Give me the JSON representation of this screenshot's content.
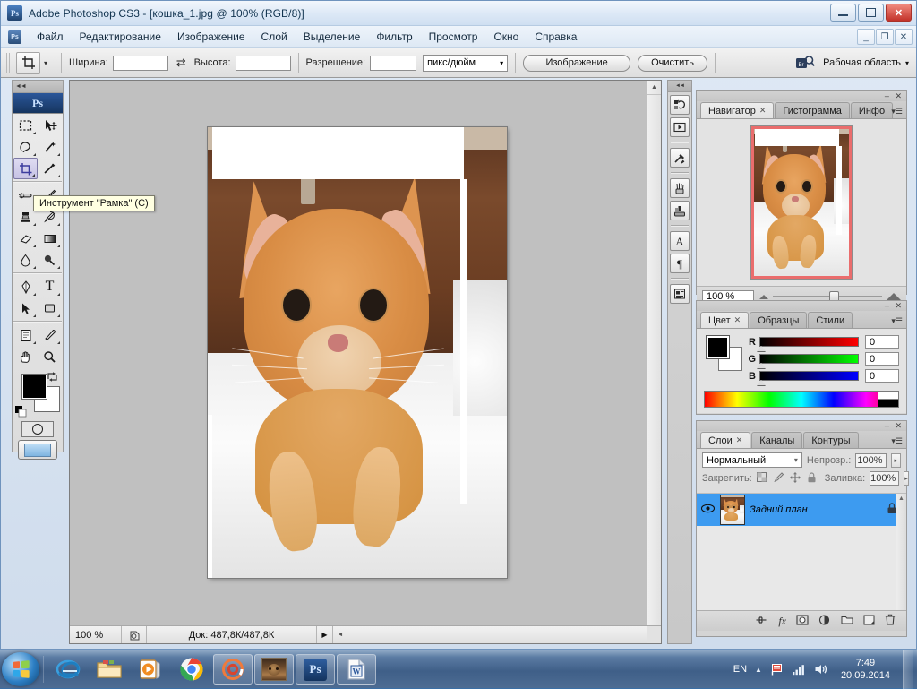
{
  "window": {
    "app_icon": "photoshop-icon",
    "title": "Adobe Photoshop CS3 - [кошка_1.jpg @ 100% (RGB/8)]",
    "minimize": "–",
    "maximize": "□",
    "close": "✕"
  },
  "menubar": {
    "items": [
      {
        "label": "Файл"
      },
      {
        "label": "Редактирование"
      },
      {
        "label": "Изображение"
      },
      {
        "label": "Слой"
      },
      {
        "label": "Выделение"
      },
      {
        "label": "Фильтр"
      },
      {
        "label": "Просмотр"
      },
      {
        "label": "Окно"
      },
      {
        "label": "Справка"
      }
    ],
    "doc_minimize": "_",
    "doc_restore": "❐",
    "doc_close": "✕"
  },
  "options_bar": {
    "tool_icon": "crop-tool-icon",
    "preset_caret": "▾",
    "width_label": "Ширина:",
    "width_value": "",
    "swap_icon": "⇄",
    "height_label": "Высота:",
    "height_value": "",
    "resolution_label": "Разрешение:",
    "resolution_value": "",
    "units_value": "пикс/дюйм",
    "units_caret": "▾",
    "image_button": "Изображение",
    "clear_button": "Очистить",
    "bridge_icon": "bridge-icon",
    "workspace_label": "Рабочая область",
    "workspace_caret": "▾"
  },
  "tool_palette": {
    "collapse_icon": "◄◄",
    "logo": "Ps",
    "tools": [
      {
        "name": "marquee-tool",
        "glyph": "▭"
      },
      {
        "name": "move-tool",
        "glyph": "➤"
      },
      {
        "name": "lasso-tool",
        "glyph": "◔"
      },
      {
        "name": "magic-wand-tool",
        "glyph": "✦"
      },
      {
        "name": "crop-tool",
        "glyph": "⌗",
        "active": true
      },
      {
        "name": "slice-tool",
        "glyph": "✂"
      },
      {
        "name": "healing-brush-tool",
        "glyph": "✏"
      },
      {
        "name": "brush-tool",
        "glyph": "🖌"
      },
      {
        "name": "clone-stamp-tool",
        "glyph": "⚑"
      },
      {
        "name": "history-brush-tool",
        "glyph": "↻"
      },
      {
        "name": "eraser-tool",
        "glyph": "▱"
      },
      {
        "name": "gradient-tool",
        "glyph": "▮"
      },
      {
        "name": "blur-tool",
        "glyph": "💧"
      },
      {
        "name": "dodge-tool",
        "glyph": "◕"
      },
      {
        "name": "pen-tool",
        "glyph": "✒"
      },
      {
        "name": "type-tool",
        "glyph": "T"
      },
      {
        "name": "path-selection-tool",
        "glyph": "➘"
      },
      {
        "name": "shape-tool",
        "glyph": "▢"
      },
      {
        "name": "notes-tool",
        "glyph": "🗒"
      },
      {
        "name": "eyedropper-tool",
        "glyph": "⚲"
      },
      {
        "name": "hand-tool",
        "glyph": "✋"
      },
      {
        "name": "zoom-tool",
        "glyph": "🔍"
      }
    ],
    "swap_colors_icon": "⇄",
    "default_colors_icon": "default-colors",
    "foreground_color": "#000000",
    "background_color": "#ffffff",
    "quick_mask_icon": "quick-mask-icon",
    "screen_mode_icon": "screen-mode-icon"
  },
  "tooltip": {
    "text": "Инструмент \"Рамка\" (C)"
  },
  "document": {
    "zoom": "100 %",
    "doc_size_icon": "doc-info-icon",
    "doc_info": "Док: 487,8К/487,8К",
    "status_arrow": "▶",
    "hscroll_left": "◄",
    "vscroll_up": "▲",
    "vscroll_down": "▼"
  },
  "dock_strip": {
    "grip": "◄◄",
    "buttons": [
      {
        "name": "history-panel-icon",
        "glyph": "↺"
      },
      {
        "name": "actions-panel-icon",
        "glyph": "▶"
      },
      {
        "name": "tool-presets-panel-icon",
        "glyph": "⚒"
      },
      {
        "name": "brushes-panel-icon",
        "glyph": "🖌"
      },
      {
        "name": "clone-source-panel-icon",
        "glyph": "⚗"
      },
      {
        "name": "character-panel-icon",
        "glyph": "A"
      },
      {
        "name": "paragraph-panel-icon",
        "glyph": "¶"
      },
      {
        "name": "layer-comps-panel-icon",
        "glyph": "▤"
      }
    ]
  },
  "navigator_panel": {
    "minimize": "–",
    "close": "✕",
    "menu_icon": "▾☰",
    "tabs": [
      {
        "label": "Навигатор",
        "active": true,
        "close": "✕"
      },
      {
        "label": "Гистограмма",
        "active": false
      },
      {
        "label": "Инфо",
        "active": false
      }
    ],
    "zoom_value": "100 %",
    "zoom_out_icon": "zoom-out-icon",
    "zoom_in_icon": "zoom-in-icon",
    "view_box_color": "#ea6d6d"
  },
  "color_panel": {
    "minimize": "–",
    "close": "✕",
    "menu_icon": "▾☰",
    "tabs": [
      {
        "label": "Цвет",
        "active": true,
        "close": "✕"
      },
      {
        "label": "Образцы",
        "active": false
      },
      {
        "label": "Стили",
        "active": false
      }
    ],
    "channels": [
      {
        "label": "R",
        "value": "0"
      },
      {
        "label": "G",
        "value": "0"
      },
      {
        "label": "B",
        "value": "0"
      }
    ],
    "foreground": "#000000",
    "background": "#ffffff"
  },
  "layers_panel": {
    "minimize": "–",
    "close": "✕",
    "menu_icon": "▾☰",
    "tabs": [
      {
        "label": "Слои",
        "active": true,
        "close": "✕"
      },
      {
        "label": "Каналы",
        "active": false
      },
      {
        "label": "Контуры",
        "active": false
      }
    ],
    "blend_mode": "Нормальный",
    "blend_caret": "▾",
    "opacity_label": "Непрозр.:",
    "opacity_value": "100%",
    "opacity_caret": "▸",
    "lock_label": "Закрепить:",
    "lock_icons": [
      {
        "name": "lock-transparency-icon",
        "glyph": "▨"
      },
      {
        "name": "lock-image-icon",
        "glyph": "🖌"
      },
      {
        "name": "lock-position-icon",
        "glyph": "✥"
      },
      {
        "name": "lock-all-icon",
        "glyph": "🔒"
      }
    ],
    "fill_label": "Заливка:",
    "fill_value": "100%",
    "fill_caret": "▸",
    "layers": [
      {
        "name": "Задний план",
        "visible_icon": "eye-icon",
        "lock_icon": "lock-icon",
        "selected": true
      }
    ],
    "footer_icons": [
      {
        "name": "link-layers-icon",
        "glyph": "⛓"
      },
      {
        "name": "layer-style-icon",
        "glyph": "fx"
      },
      {
        "name": "layer-mask-icon",
        "glyph": "◎"
      },
      {
        "name": "adjustment-layer-icon",
        "glyph": "◑"
      },
      {
        "name": "new-group-icon",
        "glyph": "▭"
      },
      {
        "name": "new-layer-icon",
        "glyph": "▣"
      },
      {
        "name": "delete-layer-icon",
        "glyph": "🗑"
      }
    ]
  },
  "taskbar": {
    "start_button": "start-orb",
    "buttons": [
      {
        "name": "internet-explorer-icon",
        "glyph": "e",
        "state": "pinned"
      },
      {
        "name": "file-explorer-icon",
        "glyph": "📁",
        "state": "pinned"
      },
      {
        "name": "media-player-icon",
        "glyph": "▶",
        "state": "pinned"
      },
      {
        "name": "chrome-icon",
        "glyph": "◉",
        "state": "pinned"
      },
      {
        "name": "mail-icon",
        "glyph": "@",
        "state": "open"
      },
      {
        "name": "photo-thumbnail-icon",
        "glyph": "🐻",
        "state": "open"
      },
      {
        "name": "photoshop-taskbar-icon",
        "glyph": "Ps",
        "state": "open"
      },
      {
        "name": "word-icon",
        "glyph": "W",
        "state": "open"
      }
    ],
    "tray": {
      "language": "EN",
      "show_hidden_icon": "▲",
      "action-center_icon": "flag-icon",
      "network_icon": "signal-icon",
      "volume_icon": "speaker-icon",
      "time": "7:49",
      "date": "20.09.2014"
    }
  }
}
